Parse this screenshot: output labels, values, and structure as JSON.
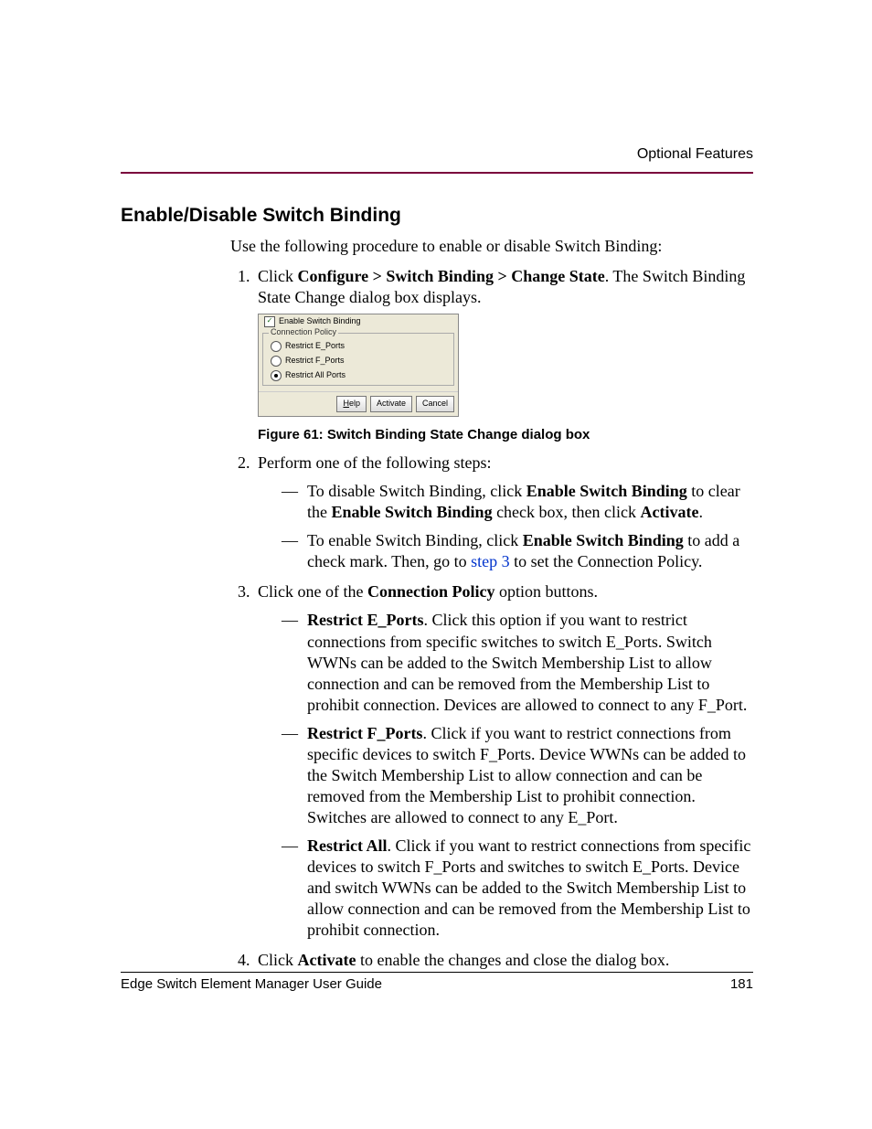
{
  "runningHead": "Optional Features",
  "sectionTitle": "Enable/Disable Switch Binding",
  "intro": "Use the following procedure to enable or disable Switch Binding:",
  "step1": {
    "pre": "Click ",
    "menu": "Configure > Switch Binding > Change State",
    "post": ". The Switch Binding State Change dialog box displays."
  },
  "dialog": {
    "enableLabel": "Enable Switch Binding",
    "groupTitle": "Connection Policy",
    "opts": [
      "Restrict E_Ports",
      "Restrict F_Ports",
      "Restrict All Ports"
    ],
    "buttons": {
      "help": "Help",
      "activate": "Activate",
      "cancel": "Cancel"
    }
  },
  "figureCaption": "Figure 61:  Switch Binding State Change dialog box",
  "step2": {
    "lead": "Perform one of the following steps:",
    "disable": {
      "t1": "To disable Switch Binding, click ",
      "b1": "Enable Switch Binding",
      "t2": " to clear the ",
      "b2": "Enable Switch Binding",
      "t3": " check box, then click ",
      "b3": "Activate",
      "t4": "."
    },
    "enable": {
      "t1": "To enable Switch Binding, click ",
      "b1": "Enable Switch Binding",
      "t2": " to add a check mark. Then, go to ",
      "link": "step 3",
      "t3": " to set the Connection Policy."
    }
  },
  "step3": {
    "lead_pre": "Click one of the ",
    "lead_bold": "Connection Policy",
    "lead_post": " option buttons.",
    "e": {
      "title": "Restrict E_Ports",
      "text": ". Click this option if you want to restrict connections from specific switches to switch E_Ports. Switch WWNs can be added to the Switch Membership List to allow connection and can be removed from the Membership List to prohibit connection. Devices are allowed to connect to any F_Port."
    },
    "f": {
      "title": "Restrict F_Ports",
      "text": ". Click if you want to restrict connections from specific devices to switch F_Ports. Device WWNs can be added to the Switch Membership List to allow connection and can be removed from the Membership List to prohibit connection. Switches are allowed to connect to any E_Port."
    },
    "all": {
      "title": "Restrict All",
      "text": ". Click if you want to restrict connections from specific devices to switch F_Ports and switches to switch E_Ports. Device and switch WWNs can be added to the Switch Membership List to allow connection and can be removed from the Membership List to prohibit connection."
    }
  },
  "step4": {
    "t1": "Click ",
    "b1": "Activate",
    "t2": " to enable the changes and close the dialog box."
  },
  "footer": {
    "guide": "Edge Switch Element Manager User Guide",
    "page": "181"
  }
}
